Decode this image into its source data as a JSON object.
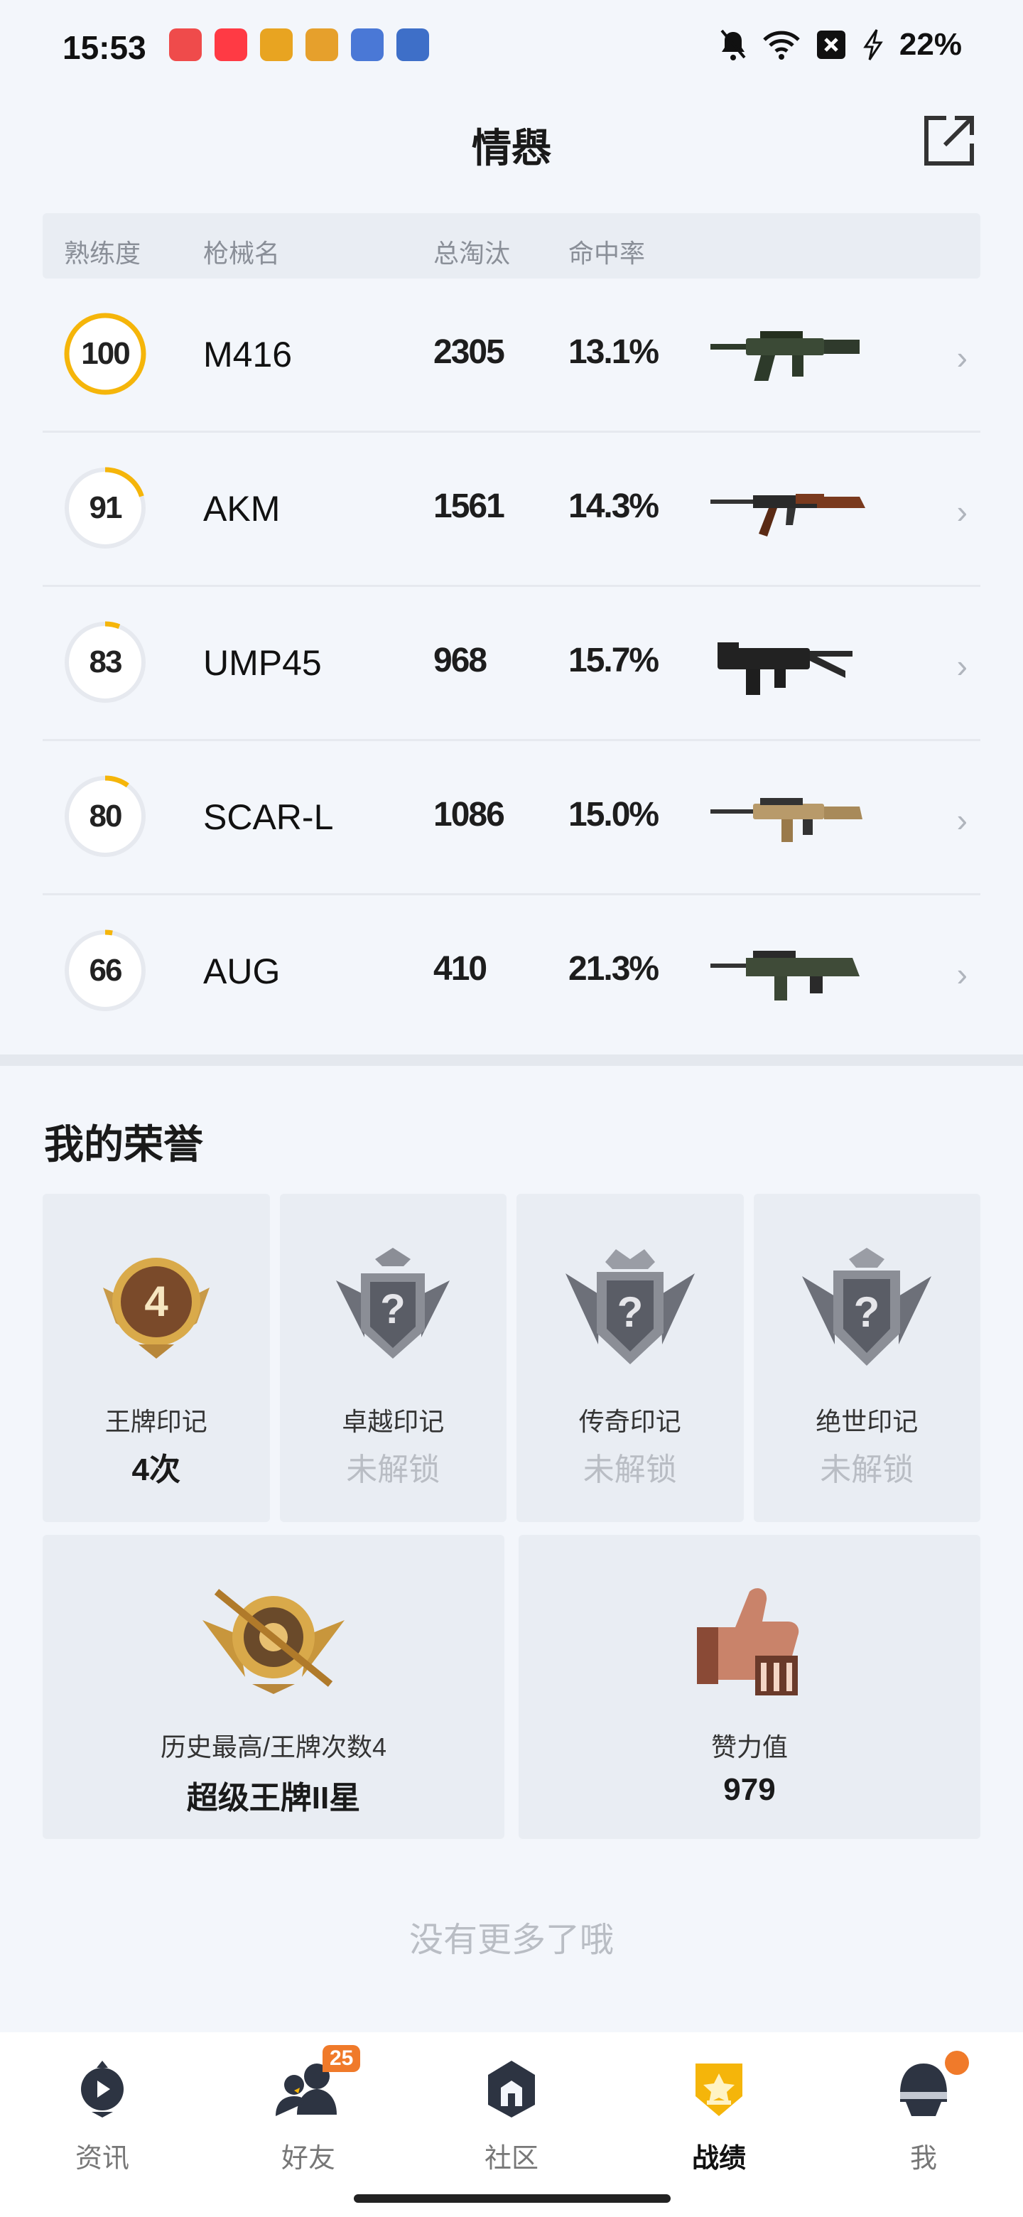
{
  "status_bar": {
    "time": "15:53",
    "battery": "22%",
    "icons": [
      "mute-bell-icon",
      "wifi-icon",
      "battery-saver-icon",
      "charging-icon"
    ]
  },
  "header": {
    "title": "情㦛"
  },
  "table": {
    "headers": {
      "proficiency": "熟练度",
      "name": "枪械名",
      "kills": "总淘汰",
      "hit_rate": "命中率"
    },
    "rows": [
      {
        "proficiency": "100",
        "proficiency_pct": 100,
        "name": "M416",
        "kills": "2305",
        "hit_rate": "13.1%",
        "gun_icon": "m416-icon"
      },
      {
        "proficiency": "91",
        "proficiency_pct": 20,
        "name": "AKM",
        "kills": "1561",
        "hit_rate": "14.3%",
        "gun_icon": "akm-icon"
      },
      {
        "proficiency": "83",
        "proficiency_pct": 6,
        "name": "UMP45",
        "kills": "968",
        "hit_rate": "15.7%",
        "gun_icon": "ump45-icon"
      },
      {
        "proficiency": "80",
        "proficiency_pct": 10,
        "name": "SCAR-L",
        "kills": "1086",
        "hit_rate": "15.0%",
        "gun_icon": "scar-l-icon"
      },
      {
        "proficiency": "66",
        "proficiency_pct": 3,
        "name": "AUG",
        "kills": "410",
        "hit_rate": "21.3%",
        "gun_icon": "aug-icon"
      }
    ]
  },
  "honors": {
    "title": "我的荣誉",
    "badges": [
      {
        "name": "王牌印记",
        "value": "4次",
        "locked": false,
        "badge_number": "4"
      },
      {
        "name": "卓越印记",
        "value": "未解锁",
        "locked": true,
        "badge_number": "?"
      },
      {
        "name": "传奇印记",
        "value": "未解锁",
        "locked": true,
        "badge_number": "?"
      },
      {
        "name": "绝世印记",
        "value": "未解锁",
        "locked": true,
        "badge_number": "?"
      }
    ],
    "stats": [
      {
        "label": "历史最高/王牌次数4",
        "value": "超级王牌II星"
      },
      {
        "label": "赞力值",
        "value": "979"
      }
    ]
  },
  "footer_text": "没有更多了哦",
  "bottom_nav": {
    "items": [
      {
        "label": "资讯",
        "icon": "news-icon",
        "active": false
      },
      {
        "label": "好友",
        "icon": "friends-icon",
        "active": false,
        "badge": "25"
      },
      {
        "label": "社区",
        "icon": "community-icon",
        "active": false
      },
      {
        "label": "战绩",
        "icon": "record-icon",
        "active": true
      },
      {
        "label": "我",
        "icon": "profile-icon",
        "active": false,
        "dot": true
      }
    ]
  },
  "colors": {
    "accent": "#f5b50a",
    "badge": "#f07a2a"
  }
}
